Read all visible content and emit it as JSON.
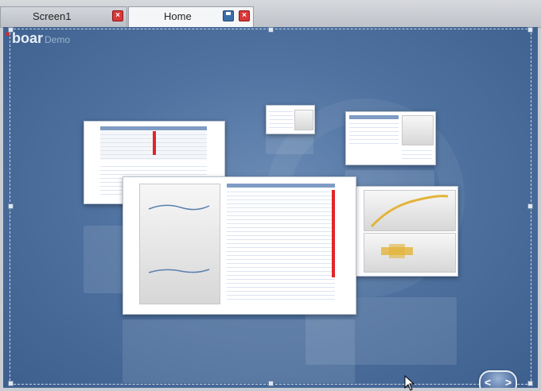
{
  "tabs": [
    {
      "label": "Screen1"
    },
    {
      "label": "Home"
    }
  ],
  "logo": {
    "brand": "boar",
    "suffix": "Demo"
  },
  "icons": {
    "close": "close-icon",
    "save": "save-icon",
    "nav": "prev-next-icon",
    "cursor": "mouse-cursor-icon"
  },
  "colors": {
    "canvas": "#4f72a0",
    "close": "#d9383a",
    "accent": "#3a6ea8"
  }
}
